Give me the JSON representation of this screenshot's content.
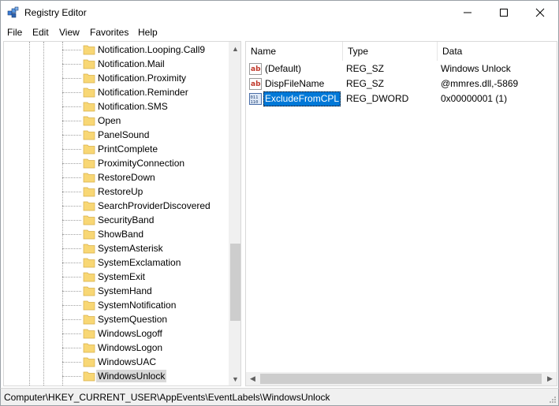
{
  "window": {
    "title": "Registry Editor"
  },
  "menu": [
    "File",
    "Edit",
    "View",
    "Favorites",
    "Help"
  ],
  "tree": {
    "items": [
      "Notification.Looping.Call9",
      "Notification.Mail",
      "Notification.Proximity",
      "Notification.Reminder",
      "Notification.SMS",
      "Open",
      "PanelSound",
      "PrintComplete",
      "ProximityConnection",
      "RestoreDown",
      "RestoreUp",
      "SearchProviderDiscovered",
      "SecurityBand",
      "ShowBand",
      "SystemAsterisk",
      "SystemExclamation",
      "SystemExit",
      "SystemHand",
      "SystemNotification",
      "SystemQuestion",
      "WindowsLogoff",
      "WindowsLogon",
      "WindowsUAC",
      "WindowsUnlock"
    ],
    "selected": "WindowsUnlock"
  },
  "list": {
    "columns": [
      "Name",
      "Type",
      "Data"
    ],
    "rows": [
      {
        "icon": "string-value-icon",
        "name": "(Default)",
        "type": "REG_SZ",
        "data": "Windows Unlock"
      },
      {
        "icon": "string-value-icon",
        "name": "DispFileName",
        "type": "REG_SZ",
        "data": "@mmres.dll,-5869"
      },
      {
        "icon": "binary-value-icon",
        "name": "ExcludeFromCPL",
        "type": "REG_DWORD",
        "data": "0x00000001 (1)"
      }
    ],
    "selected_row": 2
  },
  "status": {
    "path": "Computer\\HKEY_CURRENT_USER\\AppEvents\\EventLabels\\WindowsUnlock"
  },
  "colors": {
    "selection": "#0078d7",
    "folder": "#f8d775",
    "tree_selection": "#d9d9d9"
  }
}
